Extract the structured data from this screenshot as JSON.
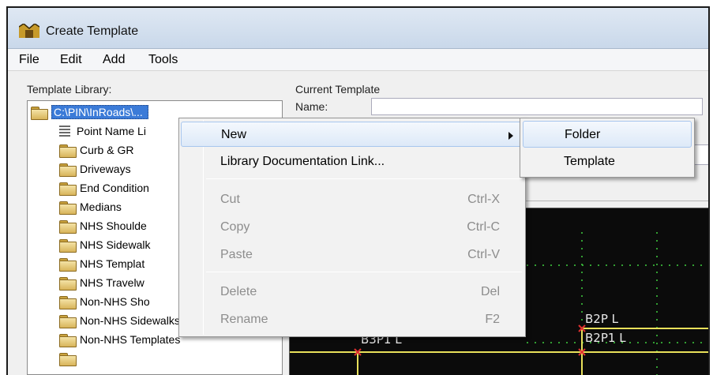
{
  "window": {
    "title": "Create Template"
  },
  "menubar": {
    "items": [
      "File",
      "Edit",
      "Add",
      "Tools"
    ]
  },
  "library": {
    "label": "Template Library:",
    "items": [
      {
        "label": "C:\\PIN\\InRoads\\...",
        "type": "root"
      },
      {
        "label": "Point Name Li",
        "type": "list"
      },
      {
        "label": "Curb & GR",
        "type": "folder"
      },
      {
        "label": "Driveways",
        "type": "folder"
      },
      {
        "label": "End Condition",
        "type": "folder"
      },
      {
        "label": "Medians",
        "type": "folder"
      },
      {
        "label": "NHS Shoulde",
        "type": "folder"
      },
      {
        "label": "NHS Sidewalk",
        "type": "folder"
      },
      {
        "label": "NHS Templat",
        "type": "folder"
      },
      {
        "label": "NHS Travelw",
        "type": "folder"
      },
      {
        "label": "Non-NHS Sho",
        "type": "folder"
      },
      {
        "label": "Non-NHS Sidewalks",
        "type": "folder"
      },
      {
        "label": "Non-NHS Templates",
        "type": "folder"
      }
    ]
  },
  "current": {
    "label": "Current Template",
    "name_label": "Name:"
  },
  "canvas": {
    "labels": [
      "B3P1 L",
      "B2P L",
      "B2P1 L"
    ]
  },
  "context_menu": {
    "new": "New",
    "doc_link": "Library Documentation Link...",
    "cut": "Cut",
    "cut_shortcut": "Ctrl-X",
    "copy": "Copy",
    "copy_shortcut": "Ctrl-C",
    "paste": "Paste",
    "paste_shortcut": "Ctrl-V",
    "delete": "Delete",
    "delete_shortcut": "Del",
    "rename": "Rename",
    "rename_shortcut": "F2"
  },
  "submenu": {
    "folder": "Folder",
    "template": "Template"
  },
  "colors": {
    "selection": "#3b7bd8",
    "canvas_bg": "#0b0b0b",
    "template_line": "#e8e05a",
    "point": "#e03030",
    "grid": "#3fcf3f"
  }
}
